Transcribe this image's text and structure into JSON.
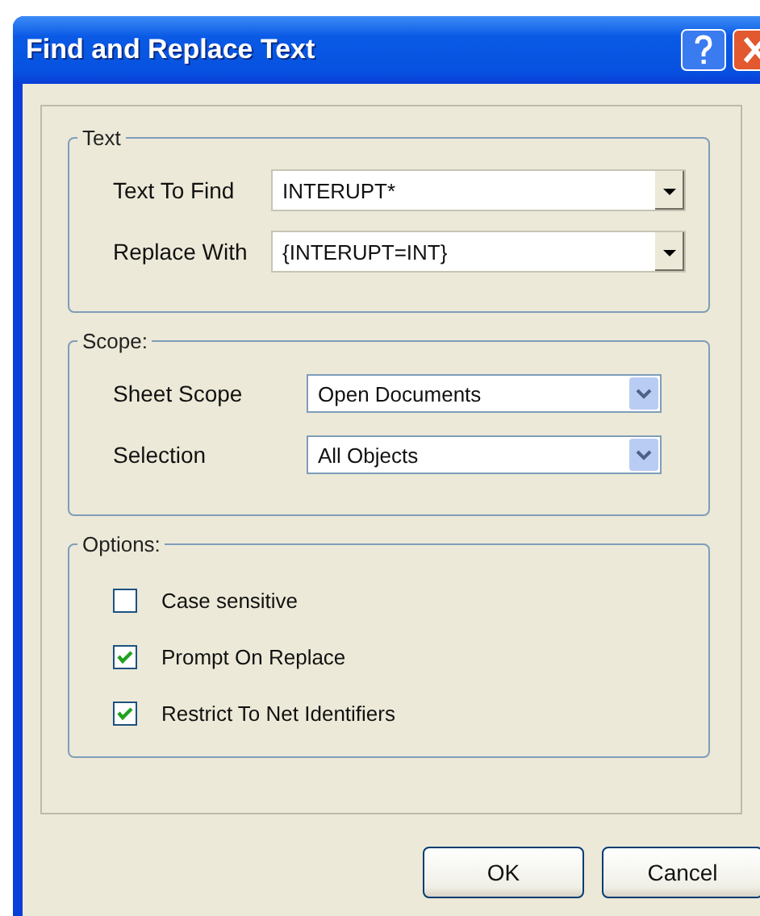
{
  "window": {
    "title": "Find and Replace Text"
  },
  "groups": [
    {
      "title": "Text",
      "fields": [
        {
          "kind": "combo",
          "label": "Text To Find",
          "value": "INTERUPT*"
        },
        {
          "kind": "combo",
          "label": "Replace With",
          "value": "{INTERUPT=INT}"
        }
      ]
    },
    {
      "title": "Scope:",
      "fields": [
        {
          "kind": "select",
          "label": "Sheet Scope",
          "value": "Open Documents"
        },
        {
          "kind": "select",
          "label": "Selection",
          "value": "All Objects"
        }
      ]
    }
  ],
  "options": {
    "title": "Options:",
    "items": [
      {
        "label": "Case sensitive",
        "checked": false
      },
      {
        "label": "Prompt On Replace",
        "checked": true
      },
      {
        "label": "Restrict To Net Identifiers",
        "checked": true
      }
    ]
  },
  "buttons": [
    "OK",
    "Cancel"
  ]
}
